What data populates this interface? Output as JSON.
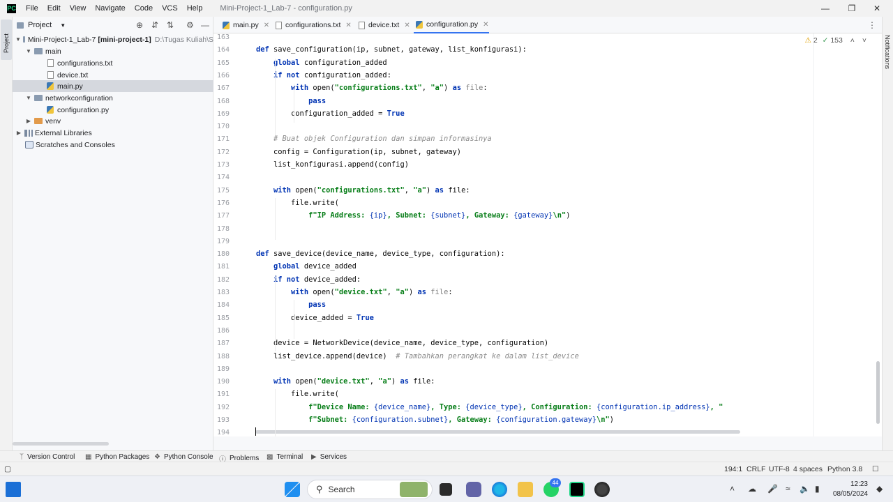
{
  "menu": [
    "File",
    "Edit",
    "View",
    "Navigate",
    "Code",
    "VCS",
    "Help"
  ],
  "window_title": "Mini-Project-1_Lab-7 - configuration.py",
  "left_stripe_label": "Project",
  "right_stripe_label": "Notifications",
  "project_panel": {
    "title": "Project",
    "tree": [
      {
        "label": "Mini-Project-1_Lab-7",
        "bold": "[mini-project-1]",
        "hint": "D:\\Tugas Kuliah\\S"
      },
      {
        "label": "main"
      },
      {
        "label": "configurations.txt"
      },
      {
        "label": "device.txt"
      },
      {
        "label": "main.py"
      },
      {
        "label": "networkconfiguration"
      },
      {
        "label": "configuration.py"
      },
      {
        "label": "venv"
      },
      {
        "label": "External Libraries"
      },
      {
        "label": "Scratches and Consoles"
      }
    ]
  },
  "tabs": [
    {
      "label": "main.py"
    },
    {
      "label": "configurations.txt"
    },
    {
      "label": "device.txt"
    },
    {
      "label": "configuration.py",
      "active": true
    }
  ],
  "inspections": {
    "warnings": "2",
    "ok": "153"
  },
  "editor": {
    "lines": [
      {
        "n": "163",
        "html": ""
      },
      {
        "n": "164",
        "html": "<span class=\"kw\">def</span> save_configuration(ip, subnet, gateway, list_konfigurasi):"
      },
      {
        "n": "165",
        "html": "    <span class=\"kw\">global</span> configuration_added"
      },
      {
        "n": "166",
        "html": "    <span class=\"kw\">if not</span> configuration_added:"
      },
      {
        "n": "167",
        "html": "        <span class=\"kw\">with</span> open(<span class=\"str\">\"configurations.txt\"</span>, <span class=\"str\">\"a\"</span>) <span class=\"kw\">as</span> <span class=\"dim\">file</span>:"
      },
      {
        "n": "168",
        "html": "            <span class=\"kw\">pass</span>"
      },
      {
        "n": "169",
        "html": "        configuration_added = <span class=\"kw\">True</span>"
      },
      {
        "n": "170",
        "html": ""
      },
      {
        "n": "171",
        "html": "    <span class=\"cmt\"># Buat objek Configuration dan simpan informasinya</span>"
      },
      {
        "n": "172",
        "html": "    config = Configuration(ip, subnet, gateway)"
      },
      {
        "n": "173",
        "html": "    list_konfigurasi.append(config)"
      },
      {
        "n": "174",
        "html": ""
      },
      {
        "n": "175",
        "html": "    <span class=\"kw\">with</span> open(<span class=\"str\">\"configurations.txt\"</span>, <span class=\"str\">\"a\"</span>) <span class=\"kw\">as</span> file:"
      },
      {
        "n": "176",
        "html": "        file.write("
      },
      {
        "n": "177",
        "html": "            <span class=\"str\">f\"IP Address: </span><span class=\"kw2\">{ip}</span><span class=\"str\">, Subnet: </span><span class=\"kw2\">{subnet}</span><span class=\"str\">, Gateway: </span><span class=\"kw2\">{gateway}</span><span class=\"str\">\\n\"</span>)"
      },
      {
        "n": "178",
        "html": ""
      },
      {
        "n": "179",
        "html": ""
      },
      {
        "n": "180",
        "html": "<span class=\"kw\">def</span> save_device(device_name, device_type, configuration):"
      },
      {
        "n": "181",
        "html": "    <span class=\"kw\">global</span> device_added"
      },
      {
        "n": "182",
        "html": "    <span class=\"kw\">if not</span> device_added:"
      },
      {
        "n": "183",
        "html": "        <span class=\"kw\">with</span> open(<span class=\"str\">\"device.txt\"</span>, <span class=\"str\">\"a\"</span>) <span class=\"kw\">as</span> <span class=\"dim\">file</span>:"
      },
      {
        "n": "184",
        "html": "            <span class=\"kw\">pass</span>"
      },
      {
        "n": "185",
        "html": "        device_added = <span class=\"kw\">True</span>"
      },
      {
        "n": "186",
        "html": ""
      },
      {
        "n": "187",
        "html": "    device = NetworkDevice(device_name, device_type, configuration)"
      },
      {
        "n": "188",
        "html": "    list_device.append(device)  <span class=\"cmt\"># Tambahkan perangkat ke dalam list_device</span>"
      },
      {
        "n": "189",
        "html": ""
      },
      {
        "n": "190",
        "html": "    <span class=\"kw\">with</span> open(<span class=\"str\">\"device.txt\"</span>, <span class=\"str\">\"a\"</span>) <span class=\"kw\">as</span> file:"
      },
      {
        "n": "191",
        "html": "        file.write("
      },
      {
        "n": "192",
        "html": "            <span class=\"str\">f\"Device Name: </span><span class=\"kw2\">{device_name}</span><span class=\"str\">, Type: </span><span class=\"kw2\">{device_type}</span><span class=\"str\">, Configuration: </span><span class=\"kw2\">{configuration.ip_address}</span><span class=\"str\">, \"</span>"
      },
      {
        "n": "193",
        "html": "            <span class=\"str\">f\"Subnet: </span><span class=\"kw2\">{configuration.subnet}</span><span class=\"str\">, Gateway: </span><span class=\"kw2\">{configuration.gateway}</span><span class=\"str\">\\n\"</span>)"
      },
      {
        "n": "194",
        "html": ""
      }
    ]
  },
  "tool_windows": [
    "Version Control",
    "Python Packages",
    "Python Console",
    "Problems",
    "Terminal",
    "Services"
  ],
  "status": {
    "position": "194:1",
    "line_sep": "CRLF",
    "encoding": "UTF-8",
    "indent": "4 spaces",
    "interpreter": "Python 3.8"
  },
  "taskbar": {
    "search_label": "Search",
    "whatsapp_badge": "44",
    "time": "12:23",
    "date": "08/05/2024"
  },
  "colors": {
    "accent": "#3574f0",
    "keyword": "#0033b3",
    "string": "#067d17",
    "comment": "#8c8c8c"
  }
}
